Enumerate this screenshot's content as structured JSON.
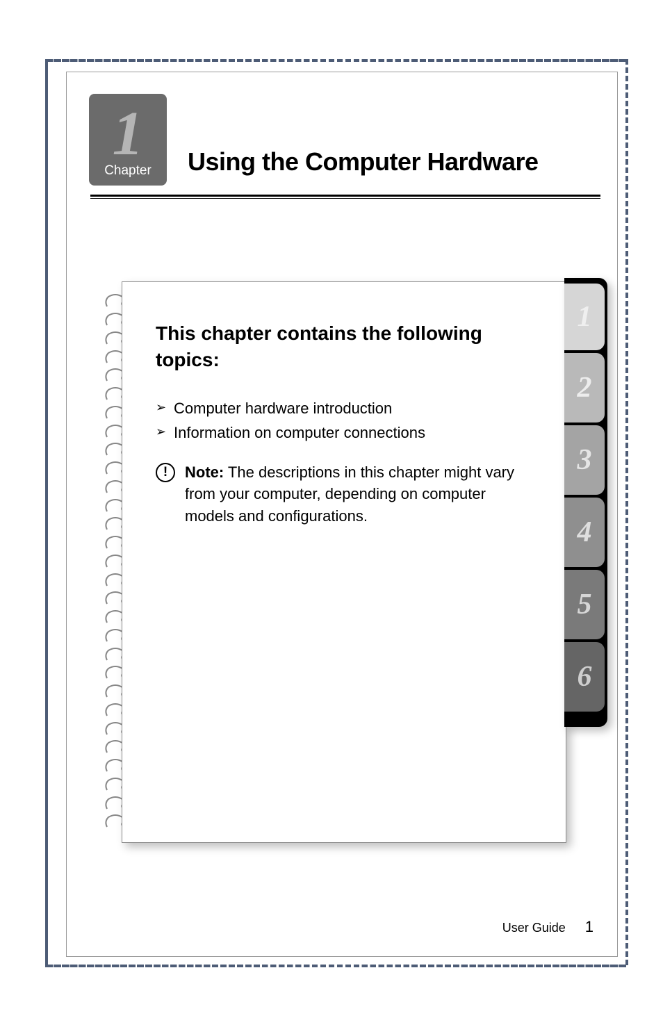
{
  "chapter": {
    "number": "1",
    "label": "Chapter",
    "title": "Using the Computer Hardware"
  },
  "topics": {
    "heading": "This chapter contains the following topics:",
    "items": [
      "Computer hardware introduction",
      "Information on computer connections"
    ]
  },
  "note": {
    "label": "Note:",
    "text": " The descriptions in this chapter might vary from your computer, depending on computer models and configurations."
  },
  "tabs": [
    "1",
    "2",
    "3",
    "4",
    "5",
    "6"
  ],
  "footer": {
    "label": "User Guide",
    "page": "1"
  }
}
